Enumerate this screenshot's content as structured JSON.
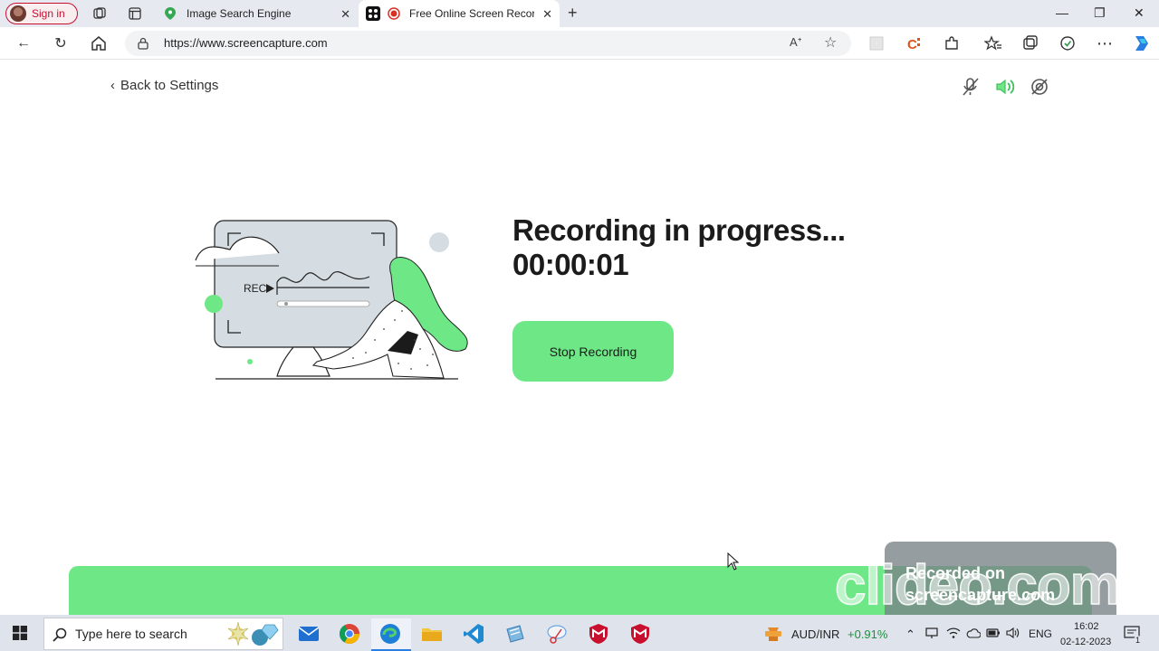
{
  "browser": {
    "signin_label": "Sign in",
    "tabs": [
      {
        "title": "Image Search Engine",
        "active": false
      },
      {
        "title": "Free Online Screen Recorde",
        "active": true
      }
    ],
    "new_tab": "+",
    "url": "https://www.screencapture.com"
  },
  "page": {
    "back_label": "Back to Settings",
    "illustration_rec_label": "REC",
    "status_title": "Recording in progress...",
    "timer": "00:00:01",
    "stop_button": "Stop Recording",
    "controls": [
      "mic-off-icon",
      "speaker-on-icon",
      "camera-off-icon"
    ]
  },
  "watermark": {
    "line1": "Recorded on",
    "line2": "screencapture.com",
    "brand": "clideo.com"
  },
  "taskbar": {
    "search_placeholder": "Type here to search",
    "ticker_name": "AUD/INR",
    "ticker_change": "+0.91%",
    "language": "ENG",
    "time": "16:02",
    "date": "02-12-2023",
    "notification_count": "1"
  },
  "colors": {
    "accent_green": "#6ee787",
    "tab_bar": "#e6e9ef",
    "taskbar": "#dfe4ec",
    "ticker_green": "#1e8f3e"
  }
}
